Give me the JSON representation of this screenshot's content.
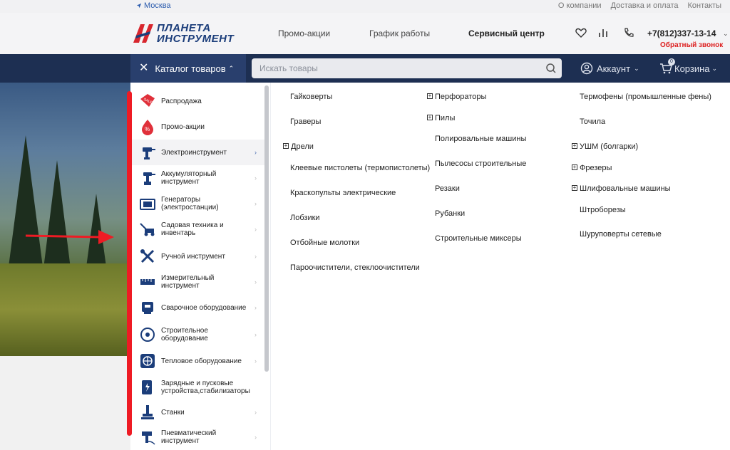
{
  "topbar": {
    "city": "Москва",
    "links": [
      "О компании",
      "Доставка и оплата",
      "Контакты"
    ]
  },
  "header": {
    "logo_line1": "ПЛАНЕТА",
    "logo_line2": "ИНСТРУМЕНТ",
    "nav": [
      "Промо-акции",
      "График работы",
      "Сервисный центр"
    ],
    "phone": "+7(812)337-13-14",
    "callback": "Обратный звонок"
  },
  "navbar": {
    "catalog_label": "Каталог товаров",
    "search_placeholder": "Искать товары",
    "account_label": "Аккаунт",
    "cart_label": "Корзина",
    "cart_count": "0"
  },
  "sidebar": {
    "items": [
      {
        "label": "Распродажа",
        "icon": "sale-tag-icon"
      },
      {
        "label": "Промо-акции",
        "icon": "promo-percent-icon"
      },
      {
        "label": "Электроинструмент",
        "icon": "drill-icon"
      },
      {
        "label": "Аккумуляторный инструмент",
        "icon": "cordless-drill-icon"
      },
      {
        "label": "Генераторы (электростанции)",
        "icon": "generator-icon"
      },
      {
        "label": "Садовая техника и инвентарь",
        "icon": "lawn-mower-icon"
      },
      {
        "label": "Ручной инструмент",
        "icon": "wrench-screwdriver-icon"
      },
      {
        "label": "Измерительный инструмент",
        "icon": "ruler-icon"
      },
      {
        "label": "Сварочное оборудование",
        "icon": "welder-icon"
      },
      {
        "label": "Строительное оборудование",
        "icon": "circular-saw-icon"
      },
      {
        "label": "Тепловое оборудование",
        "icon": "heater-fan-icon"
      },
      {
        "label": "Зарядные и пусковые устройства,стабилизаторы",
        "icon": "charger-icon"
      },
      {
        "label": "Станки",
        "icon": "machine-tool-icon"
      },
      {
        "label": "Пневматический инструмент",
        "icon": "pneumatic-tool-icon"
      }
    ]
  },
  "subcategories": {
    "col1": [
      {
        "label": "Гайковерты",
        "expandable": false
      },
      {
        "label": "Граверы",
        "expandable": false
      },
      {
        "label": "Дрели",
        "expandable": true
      },
      {
        "label": "Клеевые пистолеты (термопистолеты)",
        "expandable": false
      },
      {
        "label": "Краскопульты электрические",
        "expandable": false
      },
      {
        "label": "Лобзики",
        "expandable": false
      },
      {
        "label": "Отбойные молотки",
        "expandable": false
      },
      {
        "label": "Пароочистители, стеклоочистители",
        "expandable": false
      }
    ],
    "col2": [
      {
        "label": "Перфораторы",
        "expandable": true
      },
      {
        "label": "Пилы",
        "expandable": true
      },
      {
        "label": "Полировальные машины",
        "expandable": false
      },
      {
        "label": "Пылесосы строительные",
        "expandable": false
      },
      {
        "label": "Резаки",
        "expandable": false
      },
      {
        "label": "Рубанки",
        "expandable": false
      },
      {
        "label": "Строительные миксеры",
        "expandable": false
      }
    ],
    "col3": [
      {
        "label": "Термофены (промышленные фены)",
        "expandable": false
      },
      {
        "label": "Точила",
        "expandable": false
      },
      {
        "label": "УШМ (болгарки)",
        "expandable": true
      },
      {
        "label": "Фрезеры",
        "expandable": true
      },
      {
        "label": "Шлифовальные машины",
        "expandable": true
      },
      {
        "label": "Штроборезы",
        "expandable": false
      },
      {
        "label": "Шуруповерты сетевые",
        "expandable": false
      }
    ]
  },
  "colors": {
    "navbar": "#1d2f52",
    "catalog_button": "#293f6d",
    "brand": "#1b3d7a",
    "callback": "#dd2222",
    "annotation": "#ee1b24"
  }
}
